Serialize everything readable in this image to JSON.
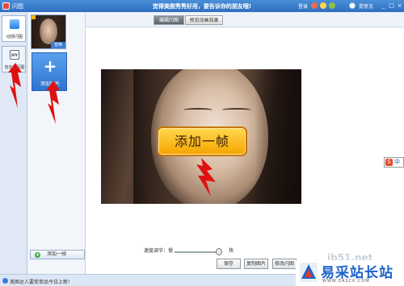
{
  "window": {
    "app_title": "闪图",
    "slogan": "觉得美图秀秀好用，要告诉你的朋友哦!",
    "login_label": "登录",
    "feedback_label": "提意见",
    "minimize_label": "_",
    "maximize_label": "□",
    "close_label": "×"
  },
  "tabs": {
    "edit_label": "编辑闪图",
    "preview_label": "预览动画效果"
  },
  "left_rail": {
    "items": [
      {
        "label": "动感闪图",
        "icon": "sparkle-icon"
      },
      {
        "label": "自定义闪图",
        "icon": "diy-icon"
      }
    ]
  },
  "frames": {
    "current_frame_tag": "替换",
    "add_image_label": "添加图片",
    "add_image_plus": "+"
  },
  "bottom": {
    "add_frame_label": "添加一帧",
    "plus_glyph": "+"
  },
  "canvas": {
    "callout_text": "添加一帧"
  },
  "speed": {
    "label": "速度调节：慢",
    "fast_label": "快",
    "value_fraction": 0.9
  },
  "actions": {
    "save_label": "保存",
    "copy_label": "复制图片",
    "edit_label": "修改闪图"
  },
  "status": {
    "text": "美图达人要受单品今日上新!"
  },
  "ime": {
    "s_glyph": "S",
    "mode": "中"
  },
  "watermark": {
    "url_fragment": "jb51.net",
    "brand": "易采站长站",
    "site": "WWW.EASCK.COM"
  },
  "colors": {
    "titlebar": "#2f6fc0",
    "accent_blue": "#3b7bd3",
    "callout_fill": "#f5a400",
    "arrow_red": "#e01010"
  }
}
